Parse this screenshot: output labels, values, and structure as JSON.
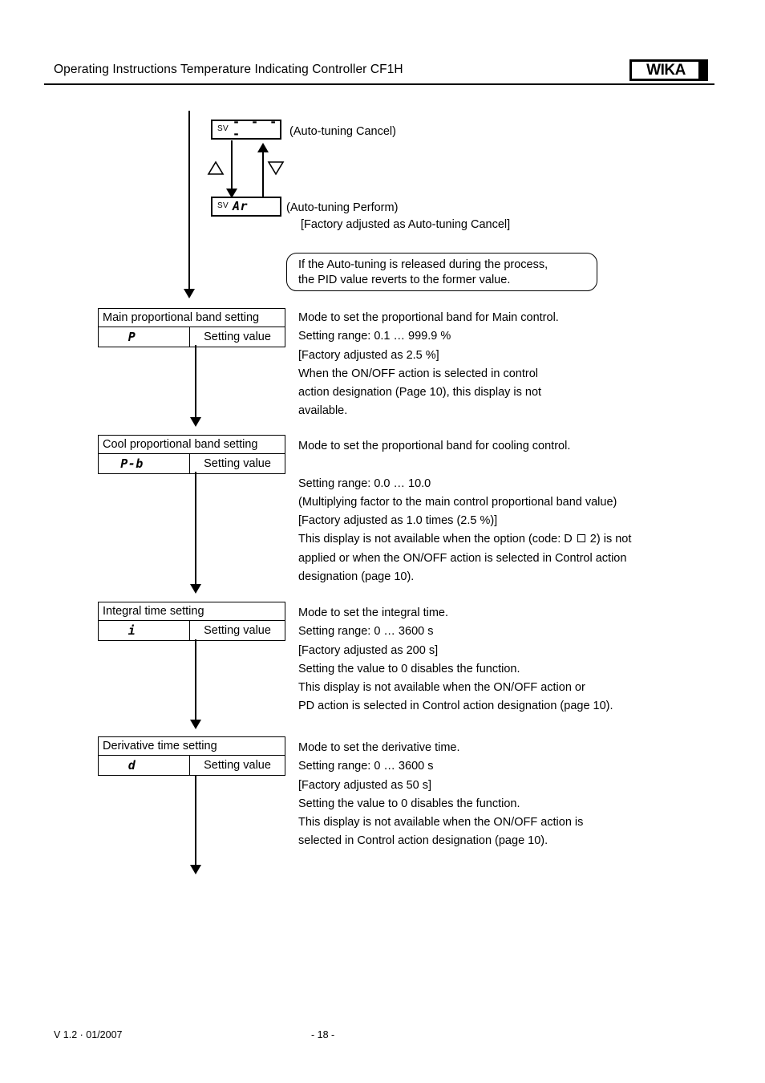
{
  "header": {
    "title": "Operating Instructions Temperature Indicating Controller CF1H",
    "logo_text": "WIKA"
  },
  "autotune": {
    "cancel_display": {
      "sv_label": "SV",
      "value": "- - - -"
    },
    "cancel_caption": "(Auto-tuning Cancel)",
    "perform_display": {
      "sv_label": "SV",
      "value": "Ar"
    },
    "perform_caption": "(Auto-tuning Perform)",
    "factory_note": "[Factory adjusted as Auto-tuning Cancel]",
    "up_key_icon": "triangle-up-icon",
    "down_key_icon": "triangle-down-icon"
  },
  "callout": {
    "line1": "If the Auto-tuning is released during the process,",
    "line2": "the PID value reverts to the former value."
  },
  "parameters": [
    {
      "title": "Main proportional band setting",
      "code": "P",
      "value_label": "Setting value",
      "description": [
        "Mode to set the proportional band for Main control.",
        "Setting range: 0.1 … 999.9 %",
        "[Factory adjusted as 2.5 %]",
        "When the ON/OFF action is selected in control",
        "action designation (Page 10), this display is not",
        "available."
      ]
    },
    {
      "title": "Cool proportional band setting",
      "code": "P-b",
      "value_label": "Setting value",
      "description": [
        "Mode to set the proportional band for cooling control.",
        "",
        "Setting range: 0.0 … 10.0",
        "(Multiplying factor to the main control proportional band value)",
        "[Factory adjusted as 1.0 times (2.5 %)]",
        "This display is not available when the option (code: D □ 2) is not",
        "applied or when the ON/OFF action is selected in Control action",
        "designation (page 10)."
      ]
    },
    {
      "title": "Integral time setting",
      "code": "i",
      "value_label": "Setting value",
      "description": [
        "Mode to set the integral time.",
        "Setting range: 0 … 3600 s",
        "[Factory adjusted as 200 s]",
        "Setting the value to 0 disables the function.",
        "This display is not available when the ON/OFF action or",
        "PD action is selected in Control action designation (page 10)."
      ]
    },
    {
      "title": "Derivative time setting",
      "code": "d",
      "value_label": "Setting value",
      "description": [
        "Mode to set the derivative time.",
        "Setting range: 0 … 3600 s",
        "[Factory adjusted as 50 s]",
        "Setting the value to 0 disables the function.",
        "This display is not available when the ON/OFF action is",
        "selected in Control action designation (page 10)."
      ]
    }
  ],
  "footer": {
    "version": "V 1.2  ·  01/2007",
    "page": "- 18 -"
  }
}
